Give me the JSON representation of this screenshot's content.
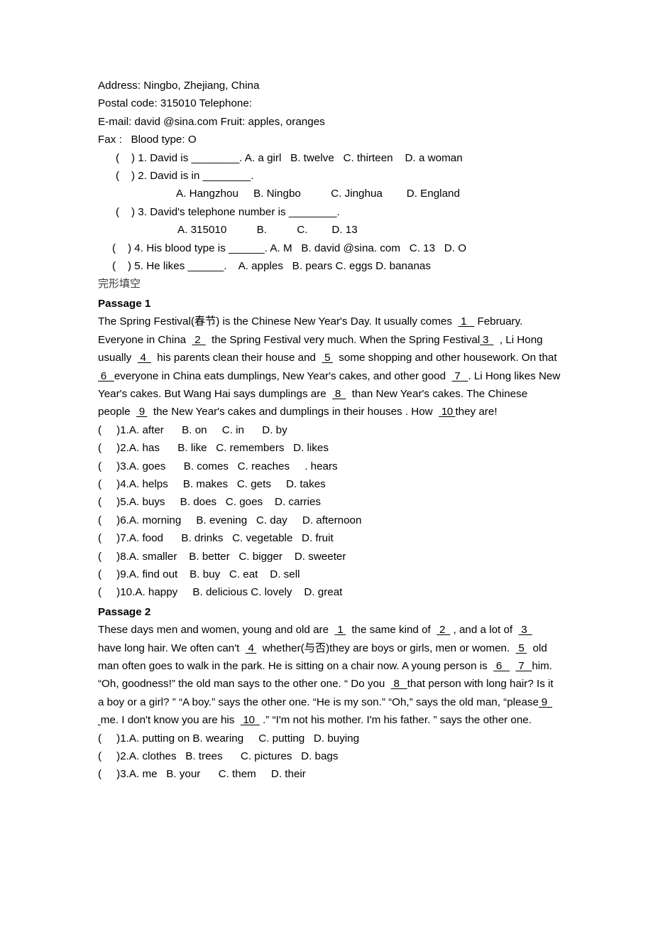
{
  "document": {
    "info_sheet": {
      "contact_lines": [
        "Address: Ningbo, Zhejiang, China",
        "Postal code: 315010 Telephone:",
        "E-mail: david @sina.com Fruit: apples, oranges",
        "Fax :   Blood type: O"
      ],
      "questions": [
        {
          "stem": "(    ) 1. David is ________. A. a girl   B. twelve   C. thirteen    D. a woman",
          "options_line": ""
        },
        {
          "stem": "(    ) 2. David is in ________.",
          "options_line": "A. Hangzhou     B. Ningbo          C. Jinghua        D. England"
        },
        {
          "stem": "(    ) 3. David's telephone number is ________.",
          "options_line": "A. 315010          B.          C.        D. 13"
        },
        {
          "stem": "(    ) 4. His blood type is ______. A. M   B. david @sina. com   C. 13   D. O",
          "options_line": ""
        },
        {
          "stem": "(    ) 5. He likes ______.    A. apples   B. pears C. eggs D. bananas",
          "options_line": ""
        }
      ]
    },
    "section_label": "完形填空",
    "passages": [
      {
        "heading": "Passage   1",
        "text_runs": [
          {
            "t": "The Spring Festival("
          },
          {
            "t": "春节",
            "cn": true
          },
          {
            "t": ") is the Chinese New Year's Day. It usually comes  "
          },
          {
            "t": "1",
            "blank": true,
            "pad": "  "
          },
          {
            "t": " February. Everyone in China  "
          },
          {
            "t": "2",
            "blank": true,
            "pad": " "
          },
          {
            "t": "  the Spring Festival very much. When the Spring Festival"
          },
          {
            "t": "3",
            "blank": true,
            "pad": " "
          },
          {
            "t": "  , Li Hong usually  "
          },
          {
            "t": "4",
            "blank": true,
            "pad": " "
          },
          {
            "t": "  his parents clean their house and  "
          },
          {
            "t": "5",
            "blank": true,
            "pad": ""
          },
          {
            "t": "  some shopping and other housework. On that  "
          },
          {
            "t": "6",
            "blank": true,
            "pad": "  "
          },
          {
            "t": "everyone in China eats dumplings, New Year's cakes, and other good  "
          },
          {
            "t": "7",
            "blank": true,
            "pad": "  "
          },
          {
            "t": ". Li Hong likes New Year's cakes. But Wang Hai says dumplings are  "
          },
          {
            "t": "8",
            "blank": true,
            "pad": " "
          },
          {
            "t": "  than New Year's cakes. The Chinese people  "
          },
          {
            "t": "9",
            "blank": true,
            "pad": ""
          },
          {
            "t": "  the New Year's cakes and dumplings in their houses . How  "
          },
          {
            "t": "10",
            "blank": true,
            "pad": ""
          },
          {
            "t": "they are!"
          }
        ],
        "choices": [
          "(     )1.A. after      B. on     C. in      D. by",
          "(     )2.A. has      B. like   C. remembers   D. likes",
          "(     )3.A. goes      B. comes   C. reaches     . hears",
          "(     )4.A. helps     B. makes   C. gets     D. takes",
          "(     )5.A. buys     B. does   C. goes    D. carries",
          "(     )6.A. morning     B. evening   C. day     D. afternoon",
          "(     )7.A. food      B. drinks   C. vegetable   D. fruit",
          "(     )8.A. smaller    B. better   C. bigger    D. sweeter",
          "(     )9.A. find out    B. buy   C. eat    D. sell",
          "(     )10.A. happy     B. delicious C. lovely    D. great"
        ]
      },
      {
        "heading": "Passage   2",
        "text_runs": [
          {
            "t": "These days men and women, young and old are  "
          },
          {
            "t": "1",
            "blank": true,
            "pad": ""
          },
          {
            "t": "  the same kind of  "
          },
          {
            "t": "2",
            "blank": true,
            "pad": " "
          },
          {
            "t": " , and a lot of  "
          },
          {
            "t": "3",
            "blank": true,
            "pad": " "
          },
          {
            "t": "  have long hair. We often can't  "
          },
          {
            "t": "4",
            "blank": true,
            "pad": ""
          },
          {
            "t": "  whether("
          },
          {
            "t": "与否",
            "cn": true
          },
          {
            "t": ")they are boys or girls, men or women.  "
          },
          {
            "t": "5",
            "blank": true,
            "pad": ""
          },
          {
            "t": "  old man often goes to walk in the park. He is sitting on a chair now. A young person is  "
          },
          {
            "t": "6",
            "blank": true,
            "pad": "  "
          },
          {
            "t": "  "
          },
          {
            "t": "7",
            "blank": true,
            "pad": "  "
          },
          {
            "t": "him."
          }
        ],
        "text_runs2": [
          {
            "t": "“Oh, goodness!” the old man says to the other one. “ Do you  "
          },
          {
            "t": "8",
            "blank": true,
            "pad": "  "
          },
          {
            "t": "that person with long hair? Is it a boy or a girl? ” “A boy.” says the other one. “He is my son.” “Oh,” says the old man, “please"
          },
          {
            "t": "9",
            "blank": true,
            "pad": "  "
          },
          {
            "t": "me. I don't know you are his  "
          },
          {
            "t": "10",
            "blank": true,
            "pad": " "
          },
          {
            "t": " .” “I'm not his mother. I'm his father. ” says the other one."
          }
        ],
        "choices": [
          "(     )1.A. putting on B. wearing     C. putting   D. buying",
          "(     )2.A. clothes   B. trees      C. pictures   D. bags",
          "(     )3.A. me   B. your      C. them     D. their"
        ]
      }
    ]
  }
}
